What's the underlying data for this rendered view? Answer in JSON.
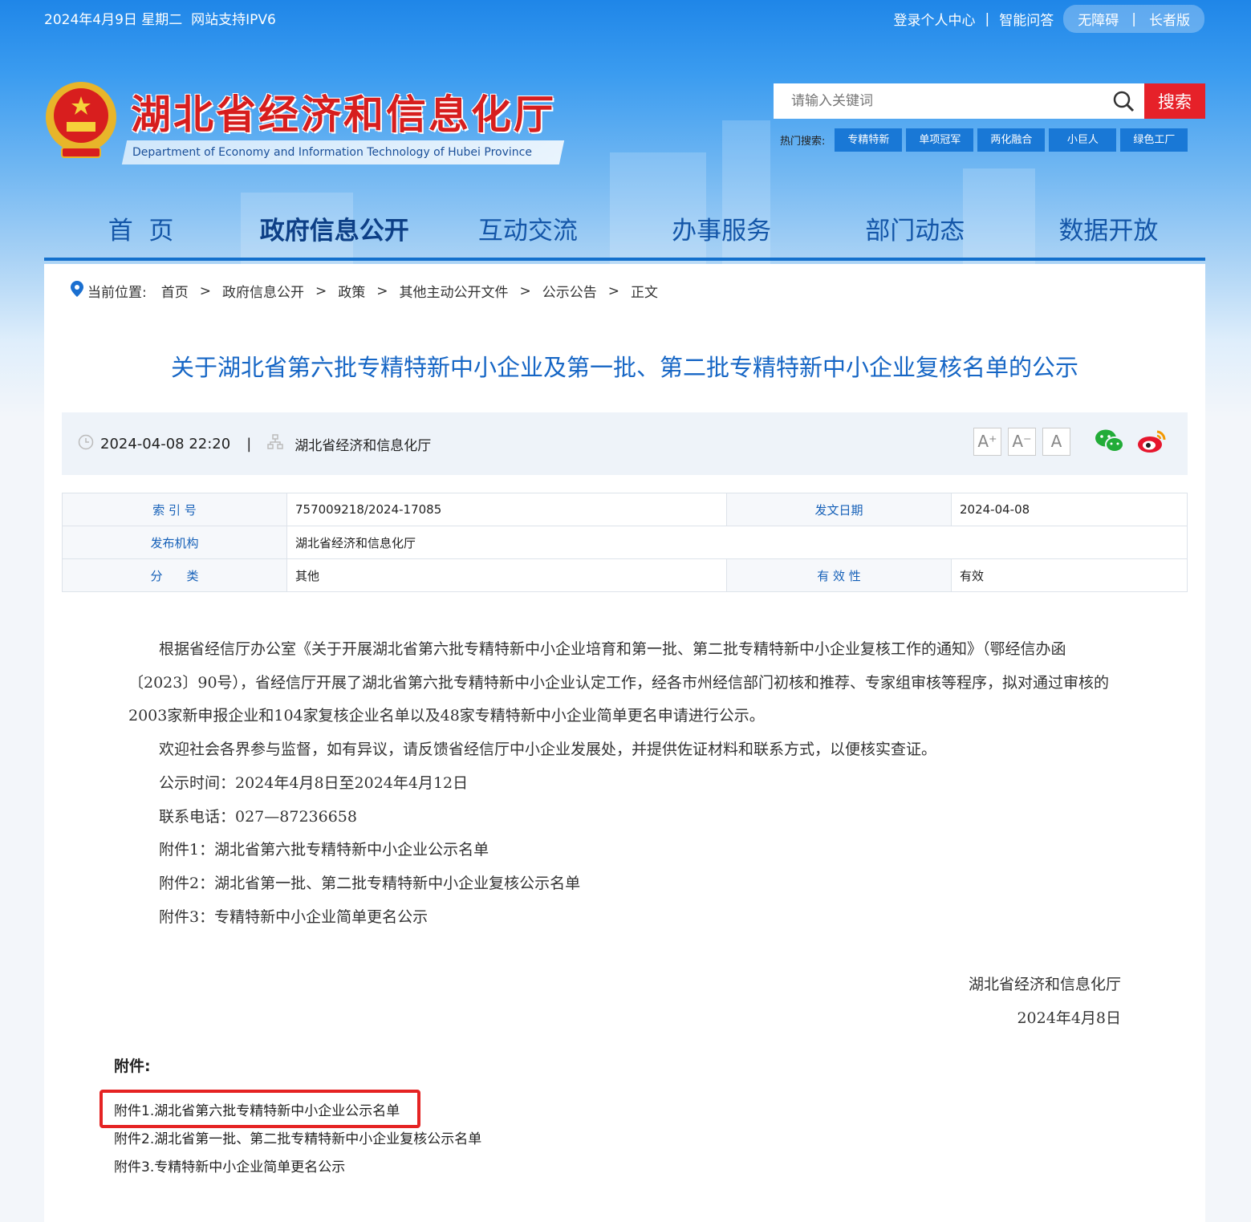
{
  "topbar": {
    "date": "2024年4月9日 星期二",
    "ipv6": "网站支持IPV6",
    "login": "登录个人中心",
    "sep": "|",
    "qa": "智能问答",
    "accessible": "无障碍",
    "elder": "长者版"
  },
  "site": {
    "title": "湖北省经济和信息化厅",
    "subtitle": "Department of Economy and Information Technology of Hubei Province"
  },
  "search": {
    "placeholder": "请输入关键词",
    "button": "搜索",
    "hot_label": "热门搜索:",
    "hot_tags": [
      "专精特新",
      "单项冠军",
      "两化融合",
      "小巨人",
      "绿色工厂"
    ]
  },
  "nav": [
    "首  页",
    "政府信息公开",
    "互动交流",
    "办事服务",
    "部门动态",
    "数据开放"
  ],
  "breadcrumb": {
    "label": "当前位置:",
    "items": [
      "首页",
      "政府信息公开",
      "政策",
      "其他主动公开文件",
      "公示公告",
      "正文"
    ],
    "sep": ">"
  },
  "article": {
    "title": "关于湖北省第六批专精特新中小企业及第一批、第二批专精特新中小企业复核名单的公示",
    "datetime": "2024-04-08 22:20",
    "source": "湖北省经济和信息化厅"
  },
  "font_sizes": [
    "A⁺",
    "A⁻",
    "A"
  ],
  "info": {
    "index_label": "索 引 号",
    "index_value": "757009218/2024-17085",
    "date_label": "发文日期",
    "date_value": "2024-04-08",
    "org_label": "发布机构",
    "org_value": "湖北省经济和信息化厅",
    "cat_label": "分　　类",
    "cat_value": "其他",
    "valid_label": "有 效 性",
    "valid_value": "有效"
  },
  "body": [
    "根据省经信厅办公室《关于开展湖北省第六批专精特新中小企业培育和第一批、第二批专精特新中小企业复核工作的通知》（鄂经信办函〔2023〕90号），省经信厅开展了湖北省第六批专精特新中小企业认定工作，经各市州经信部门初核和推荐、专家组审核等程序，拟对通过审核的2003家新申报企业和104家复核企业名单以及48家专精特新中小企业简单更名申请进行公示。",
    "欢迎社会各界参与监督，如有异议，请反馈省经信厅中小企业发展处，并提供佐证材料和联系方式，以便核实查证。",
    "公示时间：2024年4月8日至2024年4月12日",
    "联系电话：027—87236658",
    "附件1：湖北省第六批专精特新中小企业公示名单",
    "附件2：湖北省第一批、第二批专精特新中小企业复核公示名单",
    "附件3：专精特新中小企业简单更名公示"
  ],
  "signature": {
    "org": "湖北省经济和信息化厅",
    "date": "2024年4月8日"
  },
  "attachments": {
    "heading": "附件:",
    "items": [
      "附件1.湖北省第六批专精特新中小企业公示名单",
      "附件2.湖北省第一批、第二批专精特新中小企业复核公示名单",
      "附件3.专精特新中小企业简单更名公示"
    ]
  },
  "colors": {
    "brand_red": "#d71e1e",
    "nav_blue": "#1470cc",
    "title_blue": "#1666c5",
    "highlight": "#e52323"
  }
}
